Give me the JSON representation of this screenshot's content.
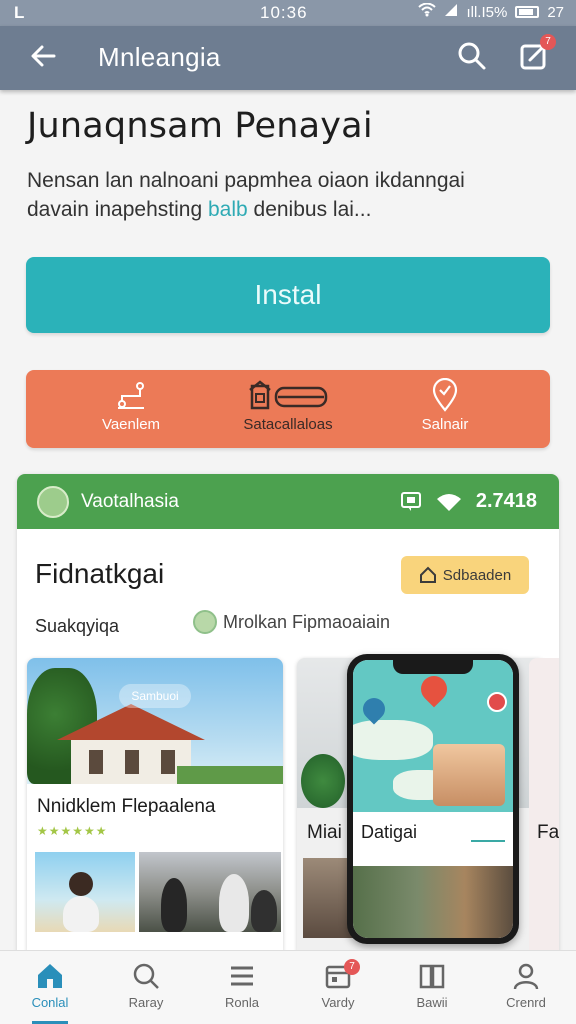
{
  "status_bar": {
    "left_glyph": "L",
    "time": "10:36",
    "battery_text": "ıll.I5%",
    "clock_right": "27"
  },
  "app_bar": {
    "title": "Mnleangia",
    "notification_count": "7"
  },
  "headline": "Junaqnsam Penayai",
  "description": {
    "line1": "Nensan lan nalnoani papmhea oiaon ikdanngai",
    "line2_a": "davain inapehsting ",
    "line2_hl": "balb",
    "line2_b": " denibus lai..."
  },
  "install_label": "Instal",
  "shortcuts": [
    {
      "icon": "route-icon",
      "label": "Vaenlem"
    },
    {
      "icon": "bus-icon",
      "label": "Satacallaloas"
    },
    {
      "icon": "location-pin-icon",
      "label": "Salnair"
    }
  ],
  "card": {
    "header_name": "Vaotalhasia",
    "header_value": "2.7418",
    "title": "Fidnatkgai",
    "action_label": "Sdbaaden",
    "subtitle": "Suakqyiqa",
    "author": "Mrolkan Fipmaoaiain",
    "tile1": {
      "badge": "Sambuoi",
      "title": "Nnidklem Flepaalena",
      "stars": "★★★★★★"
    },
    "tile2": {
      "title": "Miai"
    },
    "phone": {
      "title": "Datigai"
    },
    "tile3": {
      "title": "Fa"
    }
  },
  "bottom_nav": [
    {
      "icon": "home-icon",
      "label": "Conlal",
      "active": true
    },
    {
      "icon": "search-icon",
      "label": "Raray"
    },
    {
      "icon": "menu-icon",
      "label": "Ronla"
    },
    {
      "icon": "calendar-icon",
      "label": "Vardy",
      "badge": "7"
    },
    {
      "icon": "book-icon",
      "label": "Bawii"
    },
    {
      "icon": "profile-icon",
      "label": "Crenrd"
    }
  ],
  "colors": {
    "app_bar": "#6e7d91",
    "install": "#2bb2b9",
    "shortcuts": "#ec7a57",
    "card_header": "#4ca14f",
    "accent": "#2a8fba"
  }
}
